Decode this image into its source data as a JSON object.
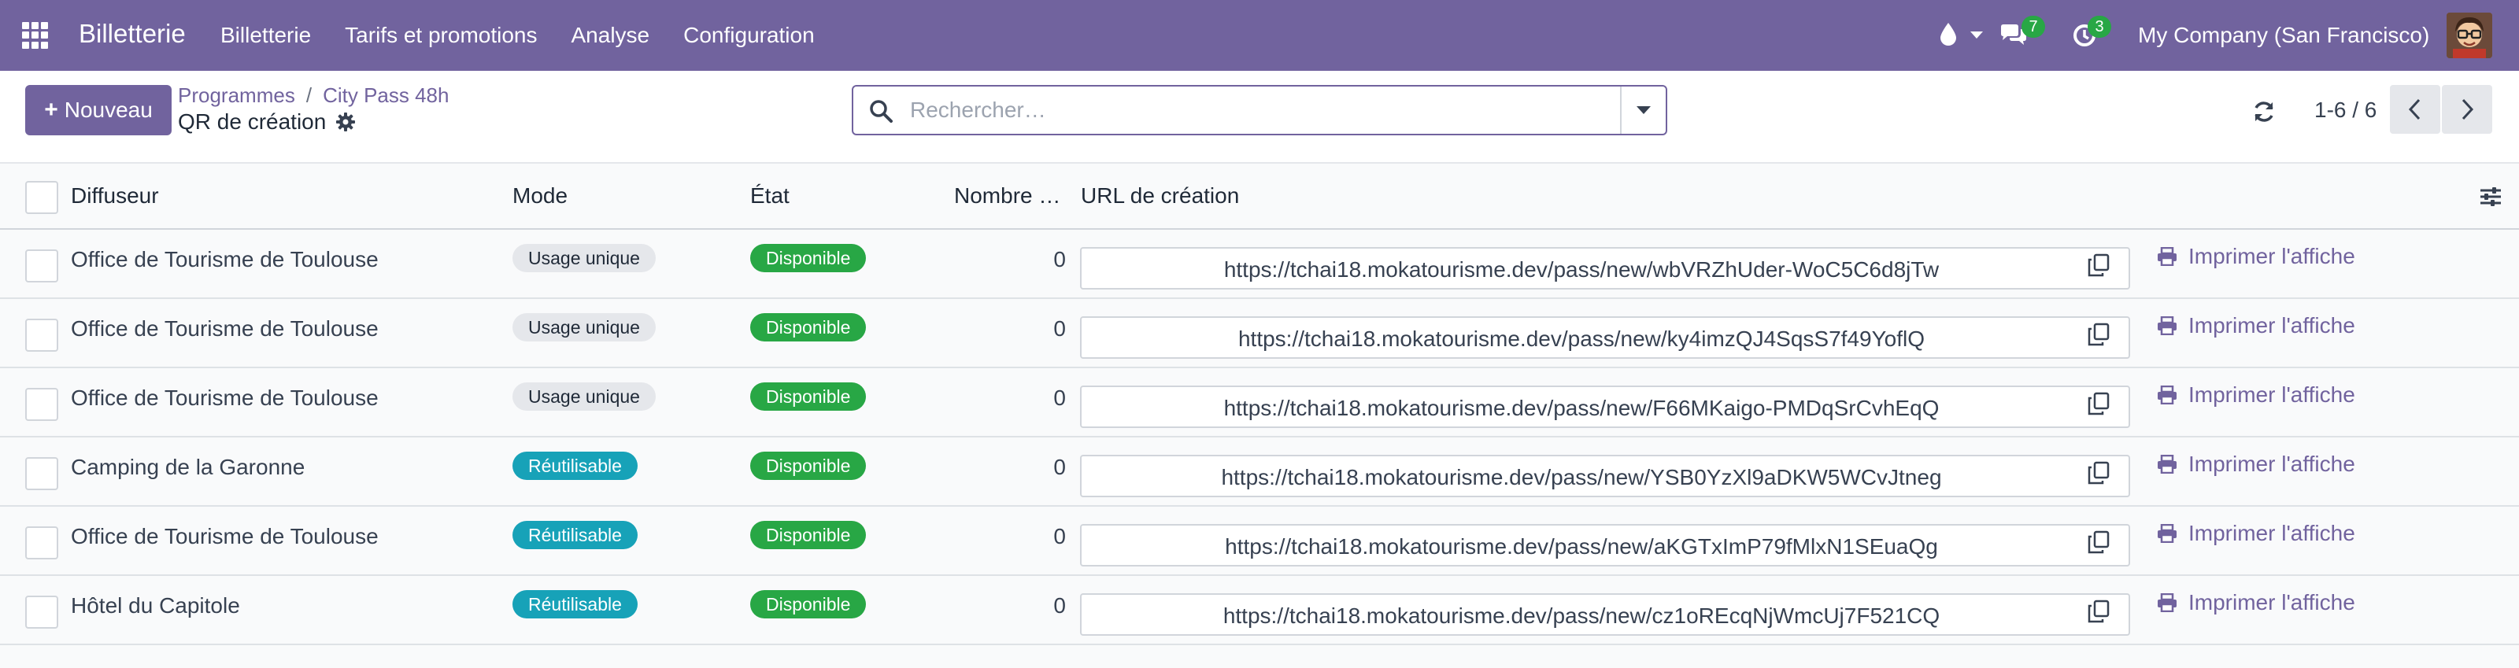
{
  "navbar": {
    "brand": "Billetterie",
    "menu": [
      "Billetterie",
      "Tarifs et promotions",
      "Analyse",
      "Configuration"
    ],
    "messages_count": "7",
    "activities_count": "3",
    "company": "My Company (San Francisco)"
  },
  "control": {
    "new_label": "Nouveau",
    "breadcrumb": [
      "Programmes",
      "City Pass 48h"
    ],
    "breadcrumb_sep": "/",
    "title": "QR de création",
    "search_placeholder": "Rechercher…",
    "pager": "1-6 / 6"
  },
  "table": {
    "columns": [
      "Diffuseur",
      "Mode",
      "État",
      "Nombre …",
      "URL de création"
    ],
    "print_label": "Imprimer l'affiche",
    "rows": [
      {
        "diffuseur": "Office de Tourisme de Toulouse",
        "mode": "Usage unique",
        "mode_kind": "unique",
        "etat": "Disponible",
        "nombre": "0",
        "url": "https://tchai18.mokatourisme.dev/pass/new/wbVRZhUder-WoC5C6d8jTw"
      },
      {
        "diffuseur": "Office de Tourisme de Toulouse",
        "mode": "Usage unique",
        "mode_kind": "unique",
        "etat": "Disponible",
        "nombre": "0",
        "url": "https://tchai18.mokatourisme.dev/pass/new/ky4imzQJ4SqsS7f49YoflQ"
      },
      {
        "diffuseur": "Office de Tourisme de Toulouse",
        "mode": "Usage unique",
        "mode_kind": "unique",
        "etat": "Disponible",
        "nombre": "0",
        "url": "https://tchai18.mokatourisme.dev/pass/new/F66MKaigo-PMDqSrCvhEqQ"
      },
      {
        "diffuseur": "Camping de la Garonne",
        "mode": "Réutilisable",
        "mode_kind": "reuse",
        "etat": "Disponible",
        "nombre": "0",
        "url": "https://tchai18.mokatourisme.dev/pass/new/YSB0YzXl9aDKW5WCvJtneg"
      },
      {
        "diffuseur": "Office de Tourisme de Toulouse",
        "mode": "Réutilisable",
        "mode_kind": "reuse",
        "etat": "Disponible",
        "nombre": "0",
        "url": "https://tchai18.mokatourisme.dev/pass/new/aKGTxImP79fMlxN1SEuaQg"
      },
      {
        "diffuseur": "Hôtel du Capitole",
        "mode": "Réutilisable",
        "mode_kind": "reuse",
        "etat": "Disponible",
        "nombre": "0",
        "url": "https://tchai18.mokatourisme.dev/pass/new/cz1oREcqNjWmcUj7F521CQ"
      }
    ]
  }
}
